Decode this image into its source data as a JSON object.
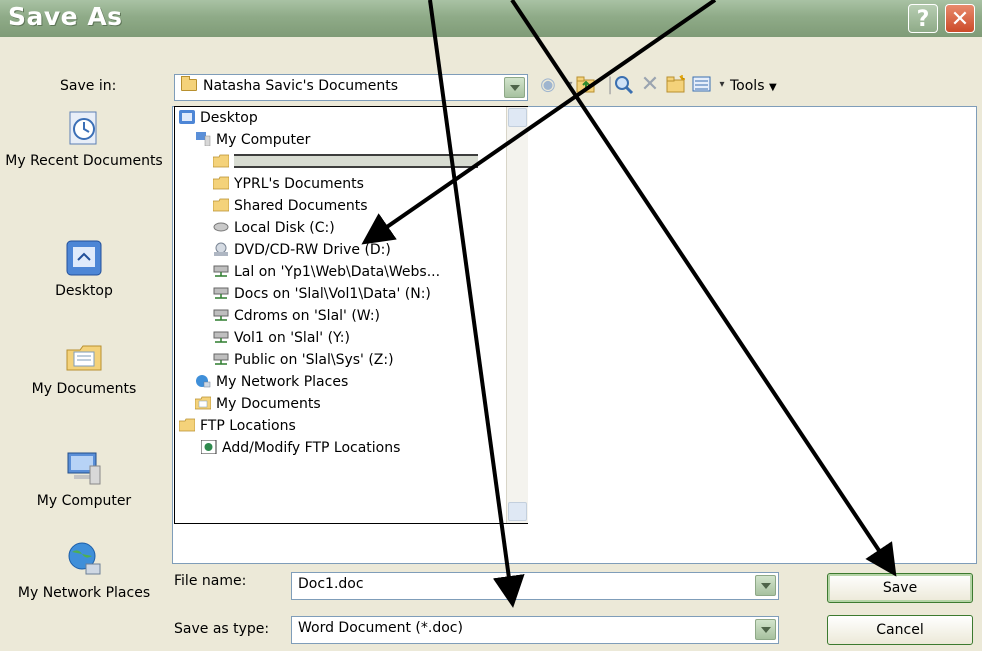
{
  "dialog": {
    "title": "Save As",
    "help_glyph": "?",
    "close_glyph": "✕"
  },
  "save_in": {
    "label": "Save in:",
    "value": "Natasha Savic's Documents"
  },
  "toolbar": {
    "tools_label": "Tools"
  },
  "places_bar": {
    "items": [
      {
        "label": "My Recent Documents",
        "icon": "recent-documents-icon"
      },
      {
        "label": "Desktop",
        "icon": "desktop-icon"
      },
      {
        "label": "My Documents",
        "icon": "my-documents-icon"
      },
      {
        "label": "My Computer",
        "icon": "my-computer-icon"
      },
      {
        "label": "My Network Places",
        "icon": "network-places-icon"
      }
    ]
  },
  "location_dropdown": {
    "items": [
      {
        "label": "Desktop",
        "icon": "desktop-icon"
      },
      {
        "label": "My Computer",
        "icon": "computer-icon"
      },
      {
        "label": "",
        "icon": "folder-icon",
        "highlighted": true
      },
      {
        "label": "YPRL's Documents",
        "icon": "folder-icon"
      },
      {
        "label": "Shared Documents",
        "icon": "folder-icon"
      },
      {
        "label": "Local Disk (C:)",
        "icon": "hard-disk-icon"
      },
      {
        "label": "DVD/CD-RW Drive (D:)",
        "icon": "optical-drive-icon"
      },
      {
        "label": "Lal on 'Yp1\\Web\\Data\\Webs...",
        "icon": "network-drive-icon"
      },
      {
        "label": "Docs on 'Slal\\Vol1\\Data' (N:)",
        "icon": "network-drive-icon"
      },
      {
        "label": "Cdroms on 'Slal' (W:)",
        "icon": "network-drive-icon"
      },
      {
        "label": "Vol1 on 'Slal' (Y:)",
        "icon": "network-drive-icon"
      },
      {
        "label": "Public on 'Slal\\Sys' (Z:)",
        "icon": "network-drive-icon"
      },
      {
        "label": "My Network Places",
        "icon": "network-places-icon"
      },
      {
        "label": "My Documents",
        "icon": "my-documents-icon"
      },
      {
        "label": "FTP Locations",
        "icon": "folder-icon"
      },
      {
        "label": "Add/Modify FTP Locations",
        "icon": "ftp-icon"
      }
    ]
  },
  "file_name": {
    "label": "File name:",
    "value": "Doc1.doc"
  },
  "save_as_type": {
    "label": "Save as type:",
    "value": "Word Document (*.doc)"
  },
  "buttons": {
    "save": "Save",
    "cancel": "Cancel"
  },
  "colors": {
    "title_bar": "#8fab88",
    "close_button": "#cc4b2a",
    "highlight": "#316ac5"
  }
}
